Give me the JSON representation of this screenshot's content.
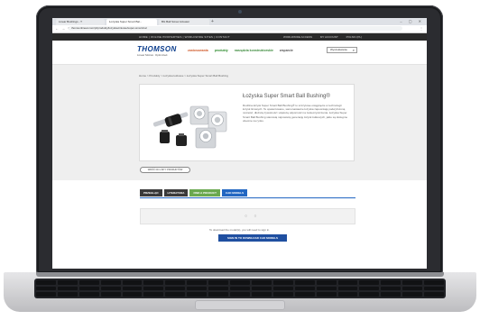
{
  "browser": {
    "tabs": [
      {
        "label": "Linear Bushings - T"
      },
      {
        "label": "Łożyska Super Smart Bal..."
      },
      {
        "label": "BG Ball Screw Actuator"
      }
    ],
    "url": "thomsonlinear.com/pl/produkty/lozyska-liniowe/super-smart-bal"
  },
  "site": {
    "utility_nav": [
      "HOME",
      "ONLINE PROPERTIES",
      "WORLDWIDE SITES",
      "CONTACT"
    ],
    "utility_right": [
      "WORLDWIDE ACCESS",
      "MY ACCOUNT",
      "POLSKI (PL)"
    ],
    "logo": {
      "main": "THOMSON",
      "sub": "Linear Motion. Optimized."
    },
    "main_nav": [
      "zastosowania",
      "produkty",
      "narzędzia konstruktorskie",
      "wsparcie"
    ],
    "search_placeholder": "Wyszukiwanie"
  },
  "breadcrumb": "Home > Produkty > Łożyska kulkowe > Łożyska Super Smart Ball Bushing",
  "product": {
    "title": "Łożyska Super Smart Ball Bushing®",
    "description": "Rodzina łożysk Super Smart Ball Bushing® to szczytowe osiągnięcie w technologii łożysk liniowych. Te opatentowane, samonastawne łożyska zapewniają podwyższoną nośność, dłuższą żywotność i większą odporność na zanieczyszczenia. Łożyska Super Smart Ball Bushing stanowią najnowszą generację łożysk kulkowych, jakie są dostępne obecnie na rynku."
  },
  "back_button": "WRÓĆ DO LISTY PRODUKTÓW",
  "tabs": [
    {
      "label": "PRZEGLĄD",
      "style": "dark"
    },
    {
      "label": "LITERATURA",
      "style": "dark"
    },
    {
      "label": "FIND A PRODUCT",
      "style": "green"
    },
    {
      "label": "CAD MODELS",
      "style": "blue"
    }
  ],
  "login_note": "To download the model(s), you will need to sign in.",
  "signin_button": "SIGN IN TO DOWNLOAD CAD MODELS",
  "colors": {
    "brand": "#0b3d8c",
    "accent_green": "#6aa84f",
    "accent_blue": "#2166c2"
  }
}
